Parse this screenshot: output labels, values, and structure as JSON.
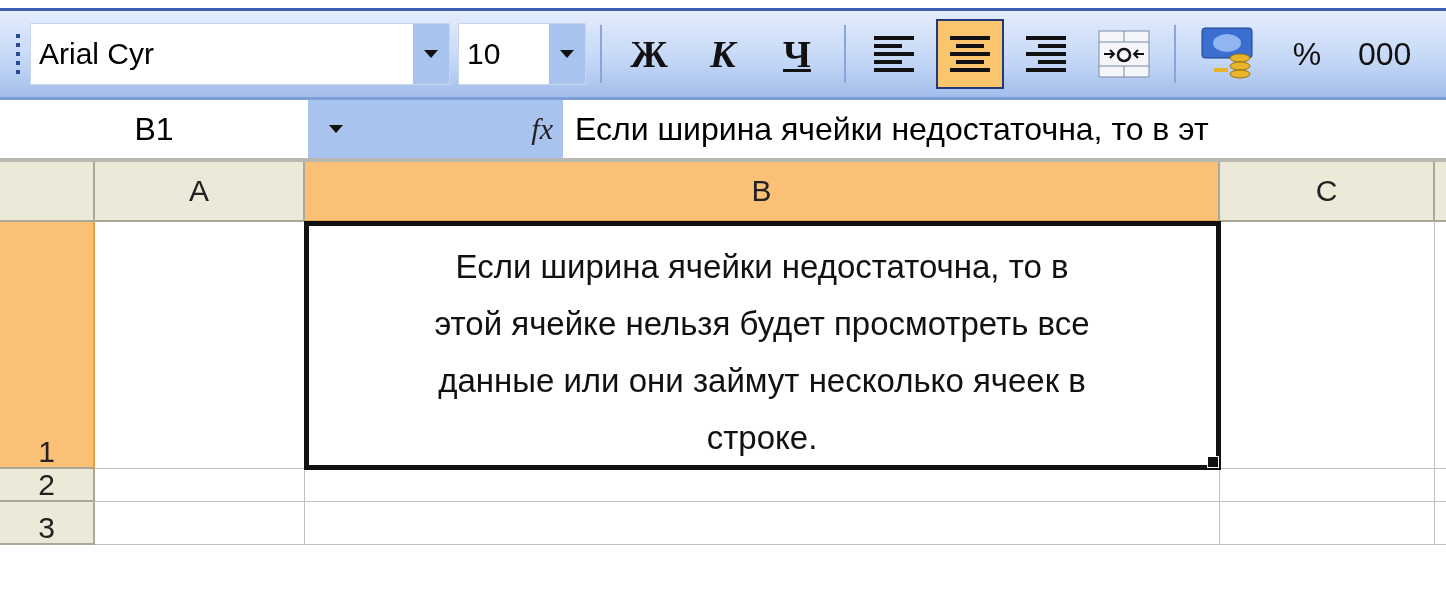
{
  "toolbar": {
    "font": {
      "value": "Arial Cyr"
    },
    "size": {
      "value": "10"
    },
    "format_buttons": [
      {
        "kind": "bold",
        "label": "Ж"
      },
      {
        "kind": "italic",
        "label": "К"
      },
      {
        "kind": "underline",
        "label": "Ч"
      }
    ],
    "align_buttons": [
      {
        "kind": "left",
        "selected": false
      },
      {
        "kind": "center",
        "selected": true
      },
      {
        "kind": "right",
        "selected": false
      },
      {
        "kind": "merge",
        "selected": false
      }
    ],
    "number_buttons": [
      {
        "kind": "currency"
      },
      {
        "kind": "text",
        "label": "%"
      },
      {
        "kind": "text",
        "label": "000"
      }
    ]
  },
  "formula_bar": {
    "name_box": "B1",
    "fx": "fx",
    "formula": "Если ширина ячейки недостаточна, то в эт"
  },
  "grid": {
    "columns": [
      {
        "label": "A",
        "selected": false
      },
      {
        "label": "B",
        "selected": true
      },
      {
        "label": "C",
        "selected": false
      }
    ],
    "rows": [
      {
        "label": "1",
        "selected": true,
        "cells": [
          {
            "active": false
          },
          {
            "active": true,
            "text": "Если ширина ячейки недостаточна, то в этой ячейке нельзя будет просмотреть все данные или они займут несколько ячеек в строке."
          },
          {
            "active": false
          }
        ]
      },
      {
        "label": "2",
        "selected": false,
        "cells": [
          {
            "active": false
          },
          {
            "active": false
          },
          {
            "active": false
          }
        ]
      },
      {
        "label": "3",
        "selected": false,
        "cells": [
          {
            "active": false
          },
          {
            "active": false
          },
          {
            "active": false
          }
        ]
      }
    ]
  }
}
